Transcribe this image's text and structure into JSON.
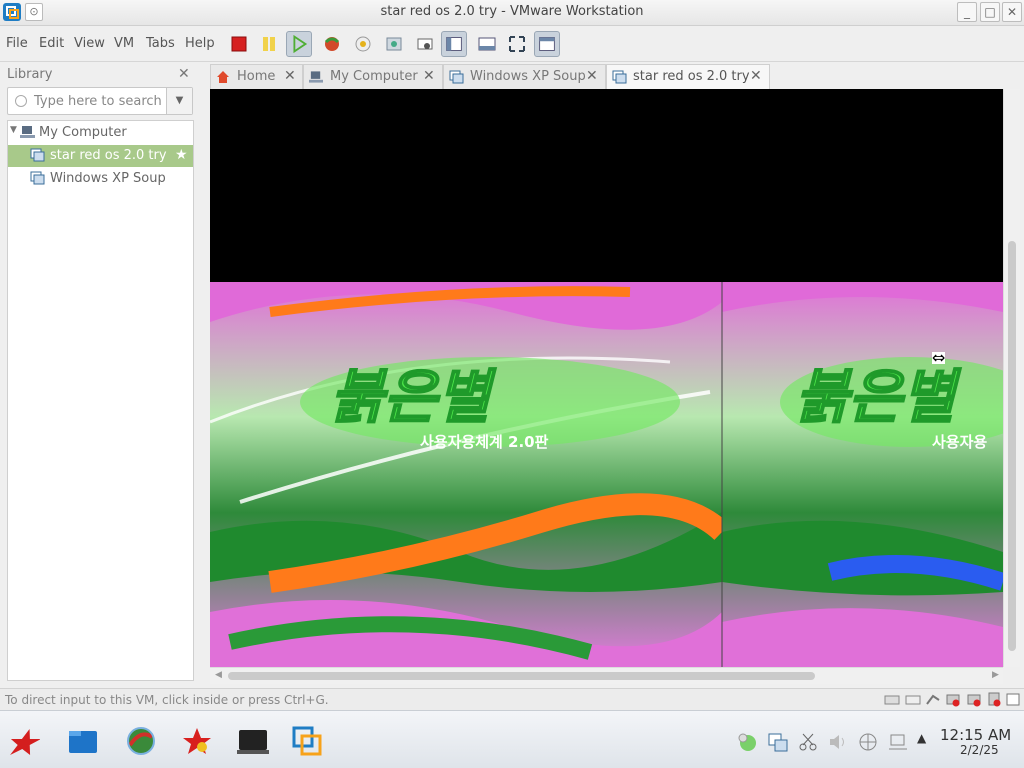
{
  "window": {
    "title": "star red os 2.0 try - VMware Workstation",
    "minimize_glyph": "_",
    "maximize_glyph": "□",
    "close_glyph": "✕"
  },
  "menu": [
    "File",
    "Edit",
    "View",
    "VM",
    "Tabs",
    "Help"
  ],
  "toolbar_icons": [
    "power-off-icon",
    "suspend-icon",
    "power-on-icon",
    "revert-snapshot-icon",
    "take-snapshot-icon",
    "snapshot-manager-icon",
    "vm-settings-icon",
    "show-library-icon",
    "show-thumbnail-bar-icon",
    "fullscreen-icon",
    "unity-icon"
  ],
  "library": {
    "label": "Library",
    "close_glyph": "✕",
    "search_placeholder": "Type here to search",
    "root": "My Computer",
    "items": [
      {
        "label": "star red os 2.0 try",
        "selected": true,
        "favorite": true
      },
      {
        "label": "Windows XP Soup",
        "selected": false,
        "favorite": false
      }
    ]
  },
  "tabs": [
    {
      "label": "Home",
      "icon": "home-icon",
      "active": false
    },
    {
      "label": "My Computer",
      "icon": "computer-icon",
      "active": false
    },
    {
      "label": "Windows XP Soup",
      "icon": "vm-icon",
      "active": false
    },
    {
      "label": "star red os 2.0 try",
      "icon": "vm-icon",
      "active": true
    }
  ],
  "tab_close_glyph": "✕",
  "guest_screen": {
    "korean_subtitle": "사용자용체계 2.0판",
    "subtitle_repeat": "사용자용"
  },
  "status": {
    "message": "To direct input to this VM, click inside or press Ctrl+G."
  },
  "taskbar": {
    "apps": [
      "red-star-menu-icon",
      "file-manager-icon",
      "browser-globe-icon",
      "red-star-app-icon",
      "terminal-icon",
      "vmware-icon"
    ],
    "tray": [
      "network-status-icon",
      "vm-network-icon",
      "scissors-icon",
      "volume-icon",
      "globe-input-icon",
      "network-computer-icon",
      "tray-expand-icon"
    ],
    "time": "12:15 AM",
    "date": "2/2/25"
  },
  "colors": {
    "accent_green": "#a8c98a",
    "vm_black": "#000000"
  }
}
